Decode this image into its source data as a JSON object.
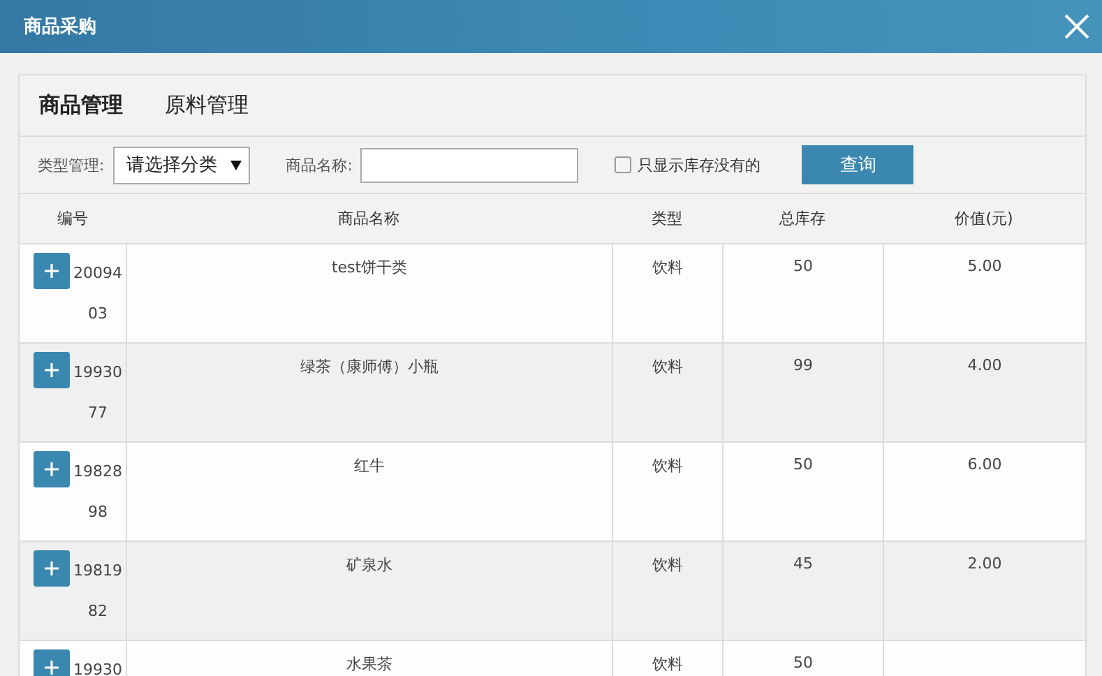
{
  "window": {
    "title": "商品采购"
  },
  "tabs": [
    {
      "label": "商品管理",
      "selected": true
    },
    {
      "label": "原料管理",
      "selected": false
    }
  ],
  "filters": {
    "category_label": "类型管理:",
    "category_value": "请选择分类",
    "name_label": "商品名称:",
    "stock_checkbox": {
      "label": "只显示库存没有的",
      "checked": false
    },
    "search_button": "查询"
  },
  "table": {
    "columns": [
      "编号",
      "商品名称",
      "类型",
      "总库存",
      "价值(元)"
    ],
    "rows": [
      {
        "id": "2009403",
        "name": "test饼干类",
        "type": "饮料",
        "stock": "50",
        "price": "5.00"
      },
      {
        "id": "1993077",
        "name": "绿茶（康师傅）小瓶",
        "type": "饮料",
        "stock": "99",
        "price": "4.00"
      },
      {
        "id": "1982898",
        "name": "红牛",
        "type": "饮料",
        "stock": "50",
        "price": "6.00"
      },
      {
        "id": "1981982",
        "name": "矿泉水",
        "type": "饮料",
        "stock": "45",
        "price": "2.00"
      },
      {
        "id": "19930",
        "name": "水果茶",
        "type": "饮料",
        "stock": "50"
      }
    ]
  }
}
